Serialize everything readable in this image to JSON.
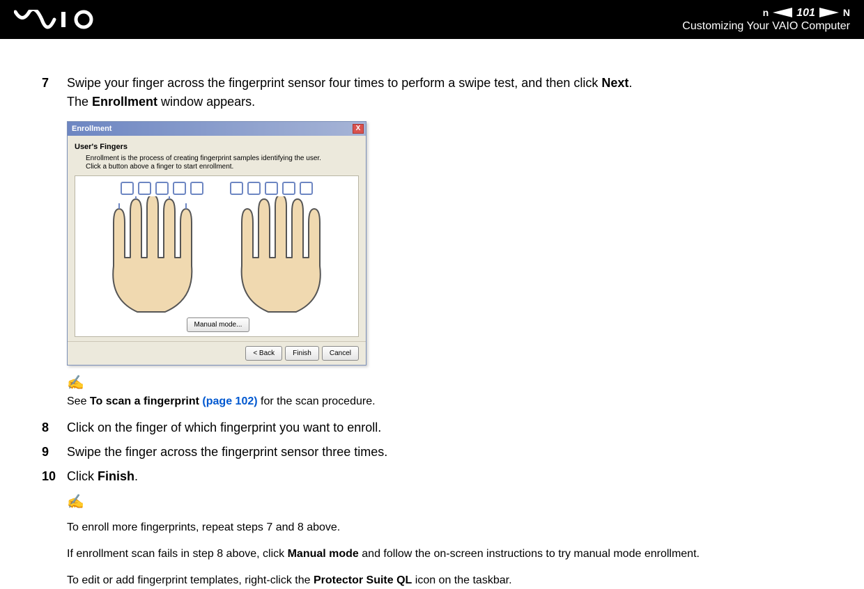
{
  "header": {
    "page_number": "101",
    "nav_letter_left": "n",
    "nav_letter_right": "N",
    "section_title": "Customizing Your VAIO Computer"
  },
  "steps": {
    "s7": {
      "num": "7",
      "line1a": "Swipe your finger across the fingerprint sensor four times to perform a swipe test, and then click ",
      "line1b": "Next",
      "line1c": ".",
      "line2a": "The ",
      "line2b": "Enrollment",
      "line2c": " window appears."
    },
    "s8": {
      "num": "8",
      "text": "Click on the finger of which fingerprint you want to enroll."
    },
    "s9": {
      "num": "9",
      "text": "Swipe the finger across the fingerprint sensor three times."
    },
    "s10": {
      "num": "10",
      "text_a": "Click ",
      "text_b": "Finish",
      "text_c": "."
    }
  },
  "enrollment_window": {
    "title": "Enrollment",
    "heading": "User's Fingers",
    "description": "Enrollment is the process of creating fingerprint samples identifying the user. Click a button above a finger to start enrollment.",
    "manual_button": "Manual mode...",
    "back_button": "< Back",
    "finish_button": "Finish",
    "cancel_button": "Cancel",
    "close_x": "X"
  },
  "note1": {
    "icon": "✍",
    "a": "See ",
    "b": "To scan a fingerprint ",
    "c": "(page 102)",
    "d": " for the scan procedure."
  },
  "note2": {
    "icon": "✍",
    "line1": "To enroll more fingerprints, repeat steps 7 and 8 above.",
    "line2a": "If enrollment scan fails in step 8 above, click ",
    "line2b": "Manual mode",
    "line2c": " and follow the on-screen instructions to try manual mode enrollment.",
    "line3a": "To edit or add fingerprint templates, right-click the ",
    "line3b": "Protector Suite QL",
    "line3c": " icon on the taskbar."
  }
}
